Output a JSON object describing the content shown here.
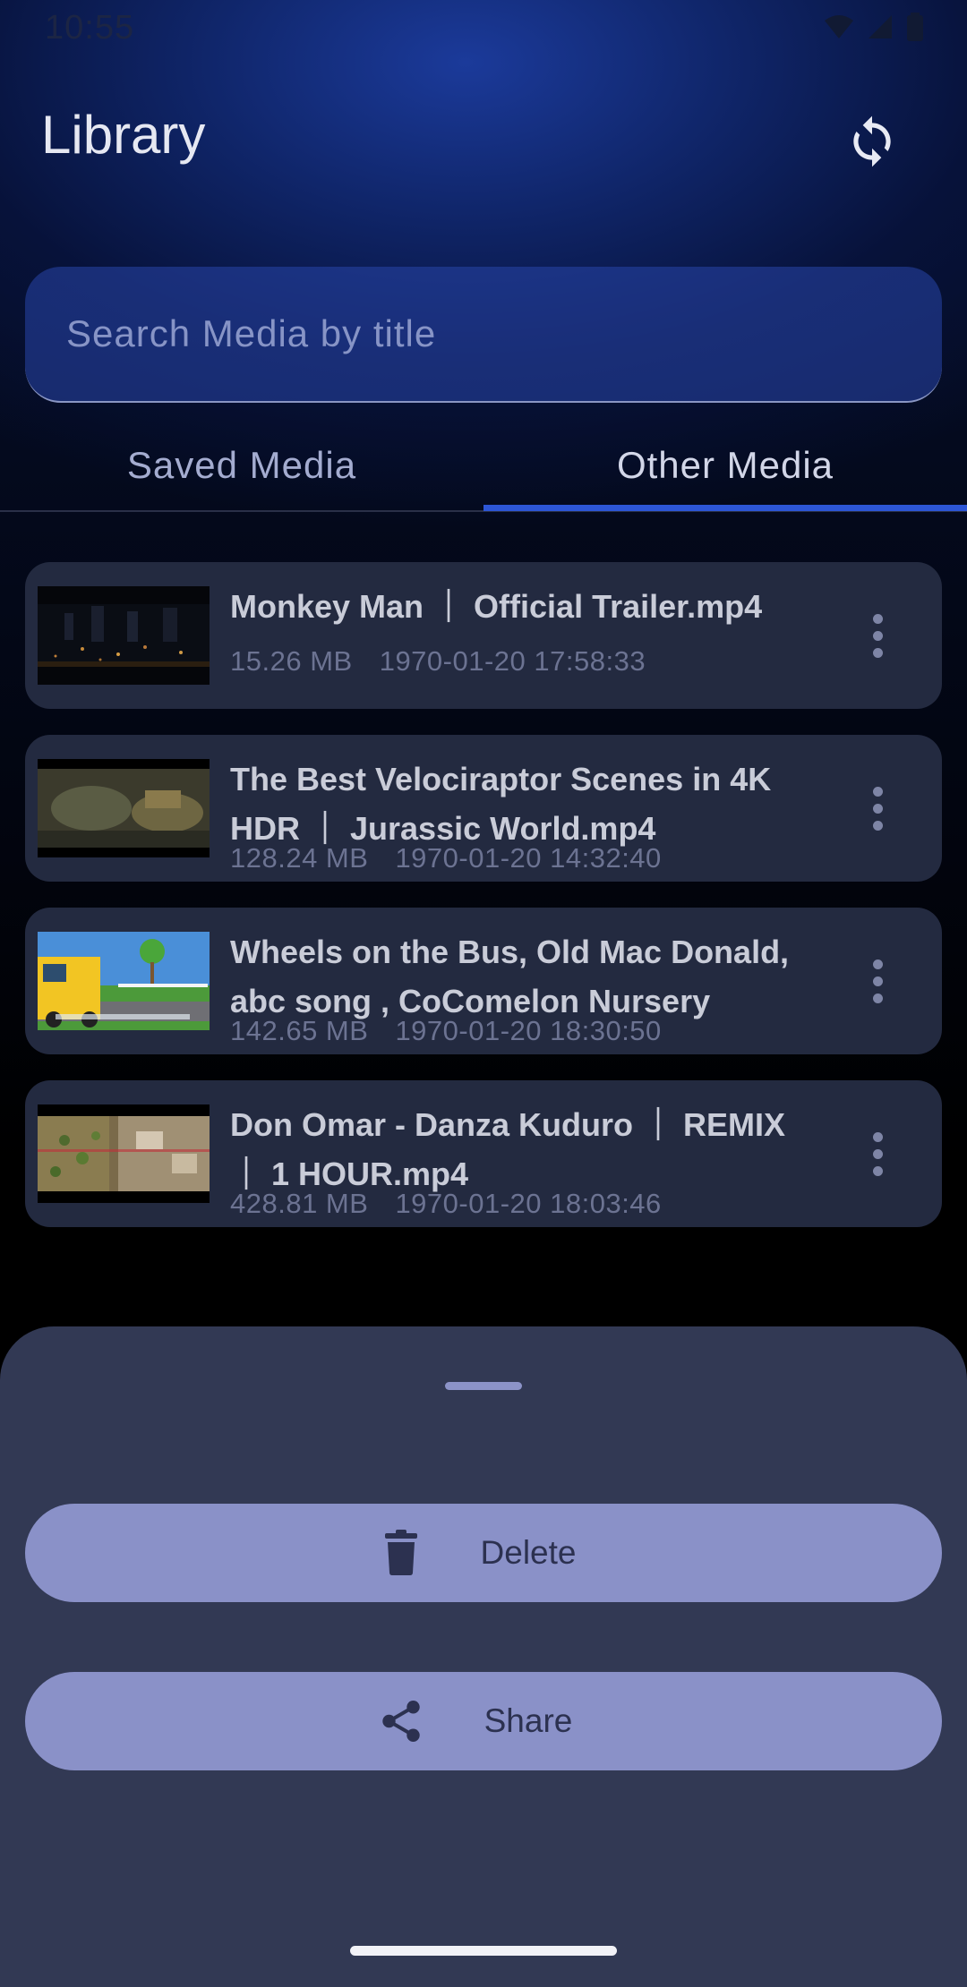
{
  "status_bar": {
    "time": "10:55"
  },
  "header": {
    "title": "Library",
    "refresh_icon": "refresh-icon"
  },
  "search": {
    "placeholder": "Search Media by title",
    "value": ""
  },
  "tabs": [
    {
      "label": "Saved Media",
      "selected": false
    },
    {
      "label": "Other Media",
      "selected": true
    }
  ],
  "media": [
    {
      "title_parts": [
        "Monkey Man",
        "Official Trailer.mp4"
      ],
      "title": "Monkey Man ｜ Official Trailer.mp4",
      "size": "15.26 MB",
      "date": "1970-01-20 17:58:33"
    },
    {
      "title": "The Best Velociraptor Scenes in 4K HDR ｜ Jurassic World.mp4",
      "size": "128.24 MB",
      "date": "1970-01-20 14:32:40"
    },
    {
      "title": "Wheels on the Bus, Old Mac Donald, abc song , CoComelon Nursery",
      "size": "142.65 MB",
      "date": "1970-01-20 18:30:50"
    },
    {
      "title": "Don Omar - Danza Kuduro ｜ REMIX ｜ 1 HOUR.mp4",
      "size": "428.81 MB",
      "date": "1970-01-20 18:03:46"
    }
  ],
  "sheet": {
    "delete_label": "Delete",
    "share_label": "Share",
    "delete_icon": "trash-icon",
    "share_icon": "share-icon"
  },
  "colors": {
    "accent": "#2d56d6",
    "card": "#232a40",
    "sheet": "#323954",
    "sheet_button": "#8a91c8"
  }
}
